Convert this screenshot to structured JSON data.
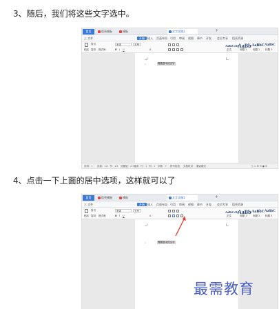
{
  "steps": [
    {
      "text": "3、随后，我们将这些文字选中。"
    },
    {
      "text": "4、点击一下上面的居中选项，这样就可以了"
    }
  ],
  "app": {
    "tabs": {
      "home": "首页",
      "daoke": "稻壳模板",
      "templates": "模板",
      "doc": "文字文稿1"
    },
    "menus": [
      "三 文件",
      "开始",
      "插入",
      "页面布局",
      "引用",
      "审阅",
      "视图",
      "章节",
      "开发",
      "会员专享",
      "稻壳资源"
    ],
    "active_menu": "开始",
    "font_name": "宋体",
    "font_size": "五号",
    "paste_label": "粘贴",
    "cut_label": "剪切",
    "copy_label": "复制",
    "format_label": "格式刷",
    "styles": [
      {
        "preview": "AaBbCcDd",
        "label": "正文"
      },
      {
        "preview": "AaBb",
        "label": "标题 1"
      },
      {
        "preview": "AaBbC",
        "label": "标题 2"
      },
      {
        "preview": "AaBbC",
        "label": "标题 3"
      }
    ],
    "selected_text": "需要居中的文字",
    "status": {
      "page": "页码：1",
      "pages": "页面：1/1",
      "section": "节：1/1",
      "position": "设置值：2.5厘米",
      "row": "行：1",
      "col": "列：1",
      "words": "字数：7",
      "spell": "拼写检查",
      "doc_check": "文档校对",
      "compat": "兼容模式"
    }
  },
  "watermark": "最需教育",
  "colors": {
    "accent": "#3d7ad8",
    "watermark": "#4b5fc4",
    "arrow": "#e53935"
  }
}
